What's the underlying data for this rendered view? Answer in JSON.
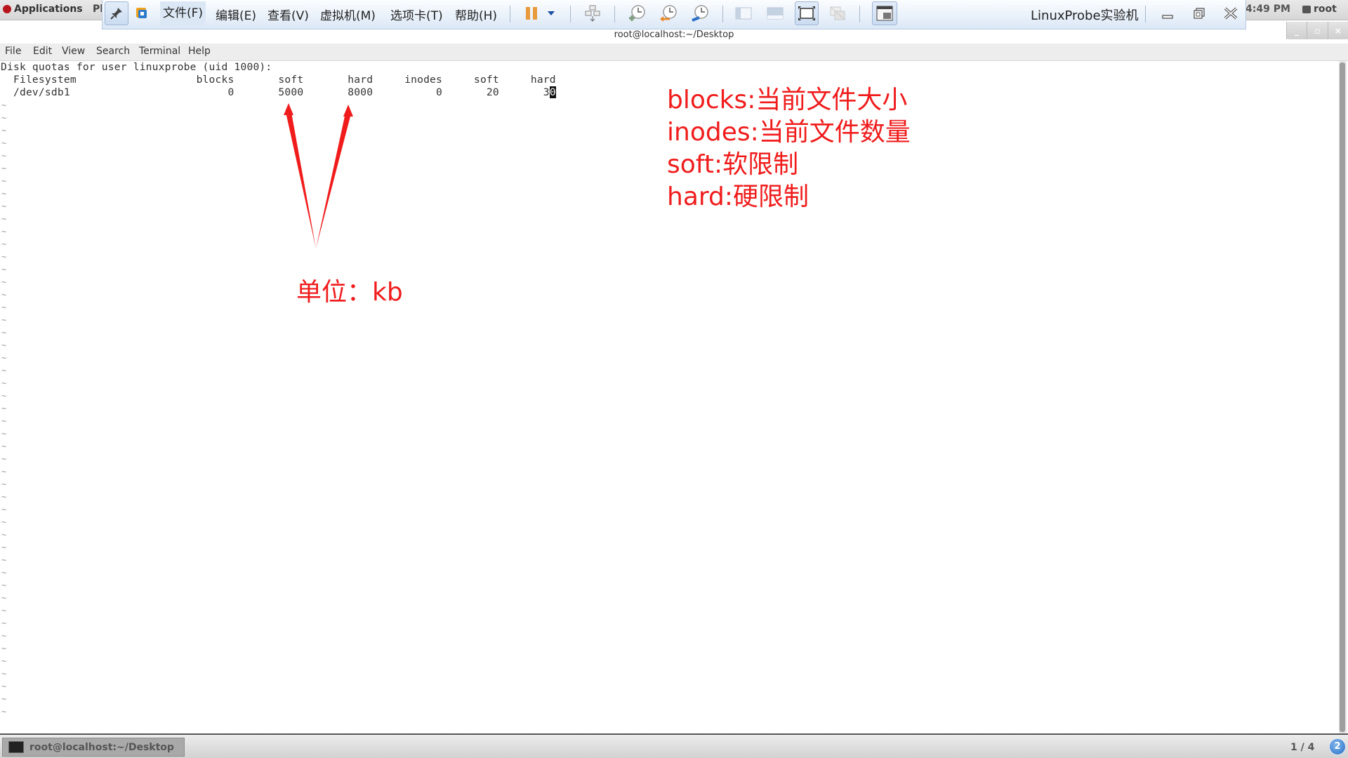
{
  "gnome_topbar": {
    "applications_label": "Applications",
    "places_label_partial": "Pl",
    "clock": "4:49 PM",
    "user": "root"
  },
  "vmware_toolbar": {
    "menus": [
      {
        "label": "文件(F)"
      },
      {
        "label": "编辑(E)"
      },
      {
        "label": "查看(V)"
      },
      {
        "label": "虚拟机(M)"
      },
      {
        "label": "选项卡(T)"
      },
      {
        "label": "帮助(H)"
      }
    ],
    "buttons": [
      "pin-icon",
      "vmware-logo-icon",
      "pause-icon",
      "dropdown-icon",
      "send-ctrl-alt-del-icon",
      "snapshot-take-icon",
      "snapshot-revert-icon",
      "snapshot-manager-icon",
      "sidebar-view-icon",
      "thumbnail-view-icon",
      "fullscreen-icon",
      "unity-icon",
      "console-view-icon"
    ],
    "vm_title": "LinuxProbe实验机"
  },
  "terminal": {
    "window_title": "root@localhost:~/Desktop",
    "menubar": [
      "File",
      "Edit",
      "View",
      "Search",
      "Terminal",
      "Help"
    ],
    "lines": [
      "Disk quotas for user linuxprobe (uid 1000):",
      "  Filesystem                   blocks       soft       hard     inodes     soft     hard",
      "  /dev/sdb1                         0       5000       8000          0       20       3"
    ],
    "cursor_char": "0",
    "tilde": "~",
    "tilde_count": 49
  },
  "annotations": {
    "legend": [
      "blocks:当前文件大小",
      "inodes:当前文件数量",
      "soft:软限制",
      "hard:硬限制"
    ],
    "unit_label": "单位：kb",
    "color": "#f01c1c"
  },
  "taskbar": {
    "task_label": "root@localhost:~/Desktop",
    "workspace": "1 / 4",
    "workspace_badge": "2"
  }
}
